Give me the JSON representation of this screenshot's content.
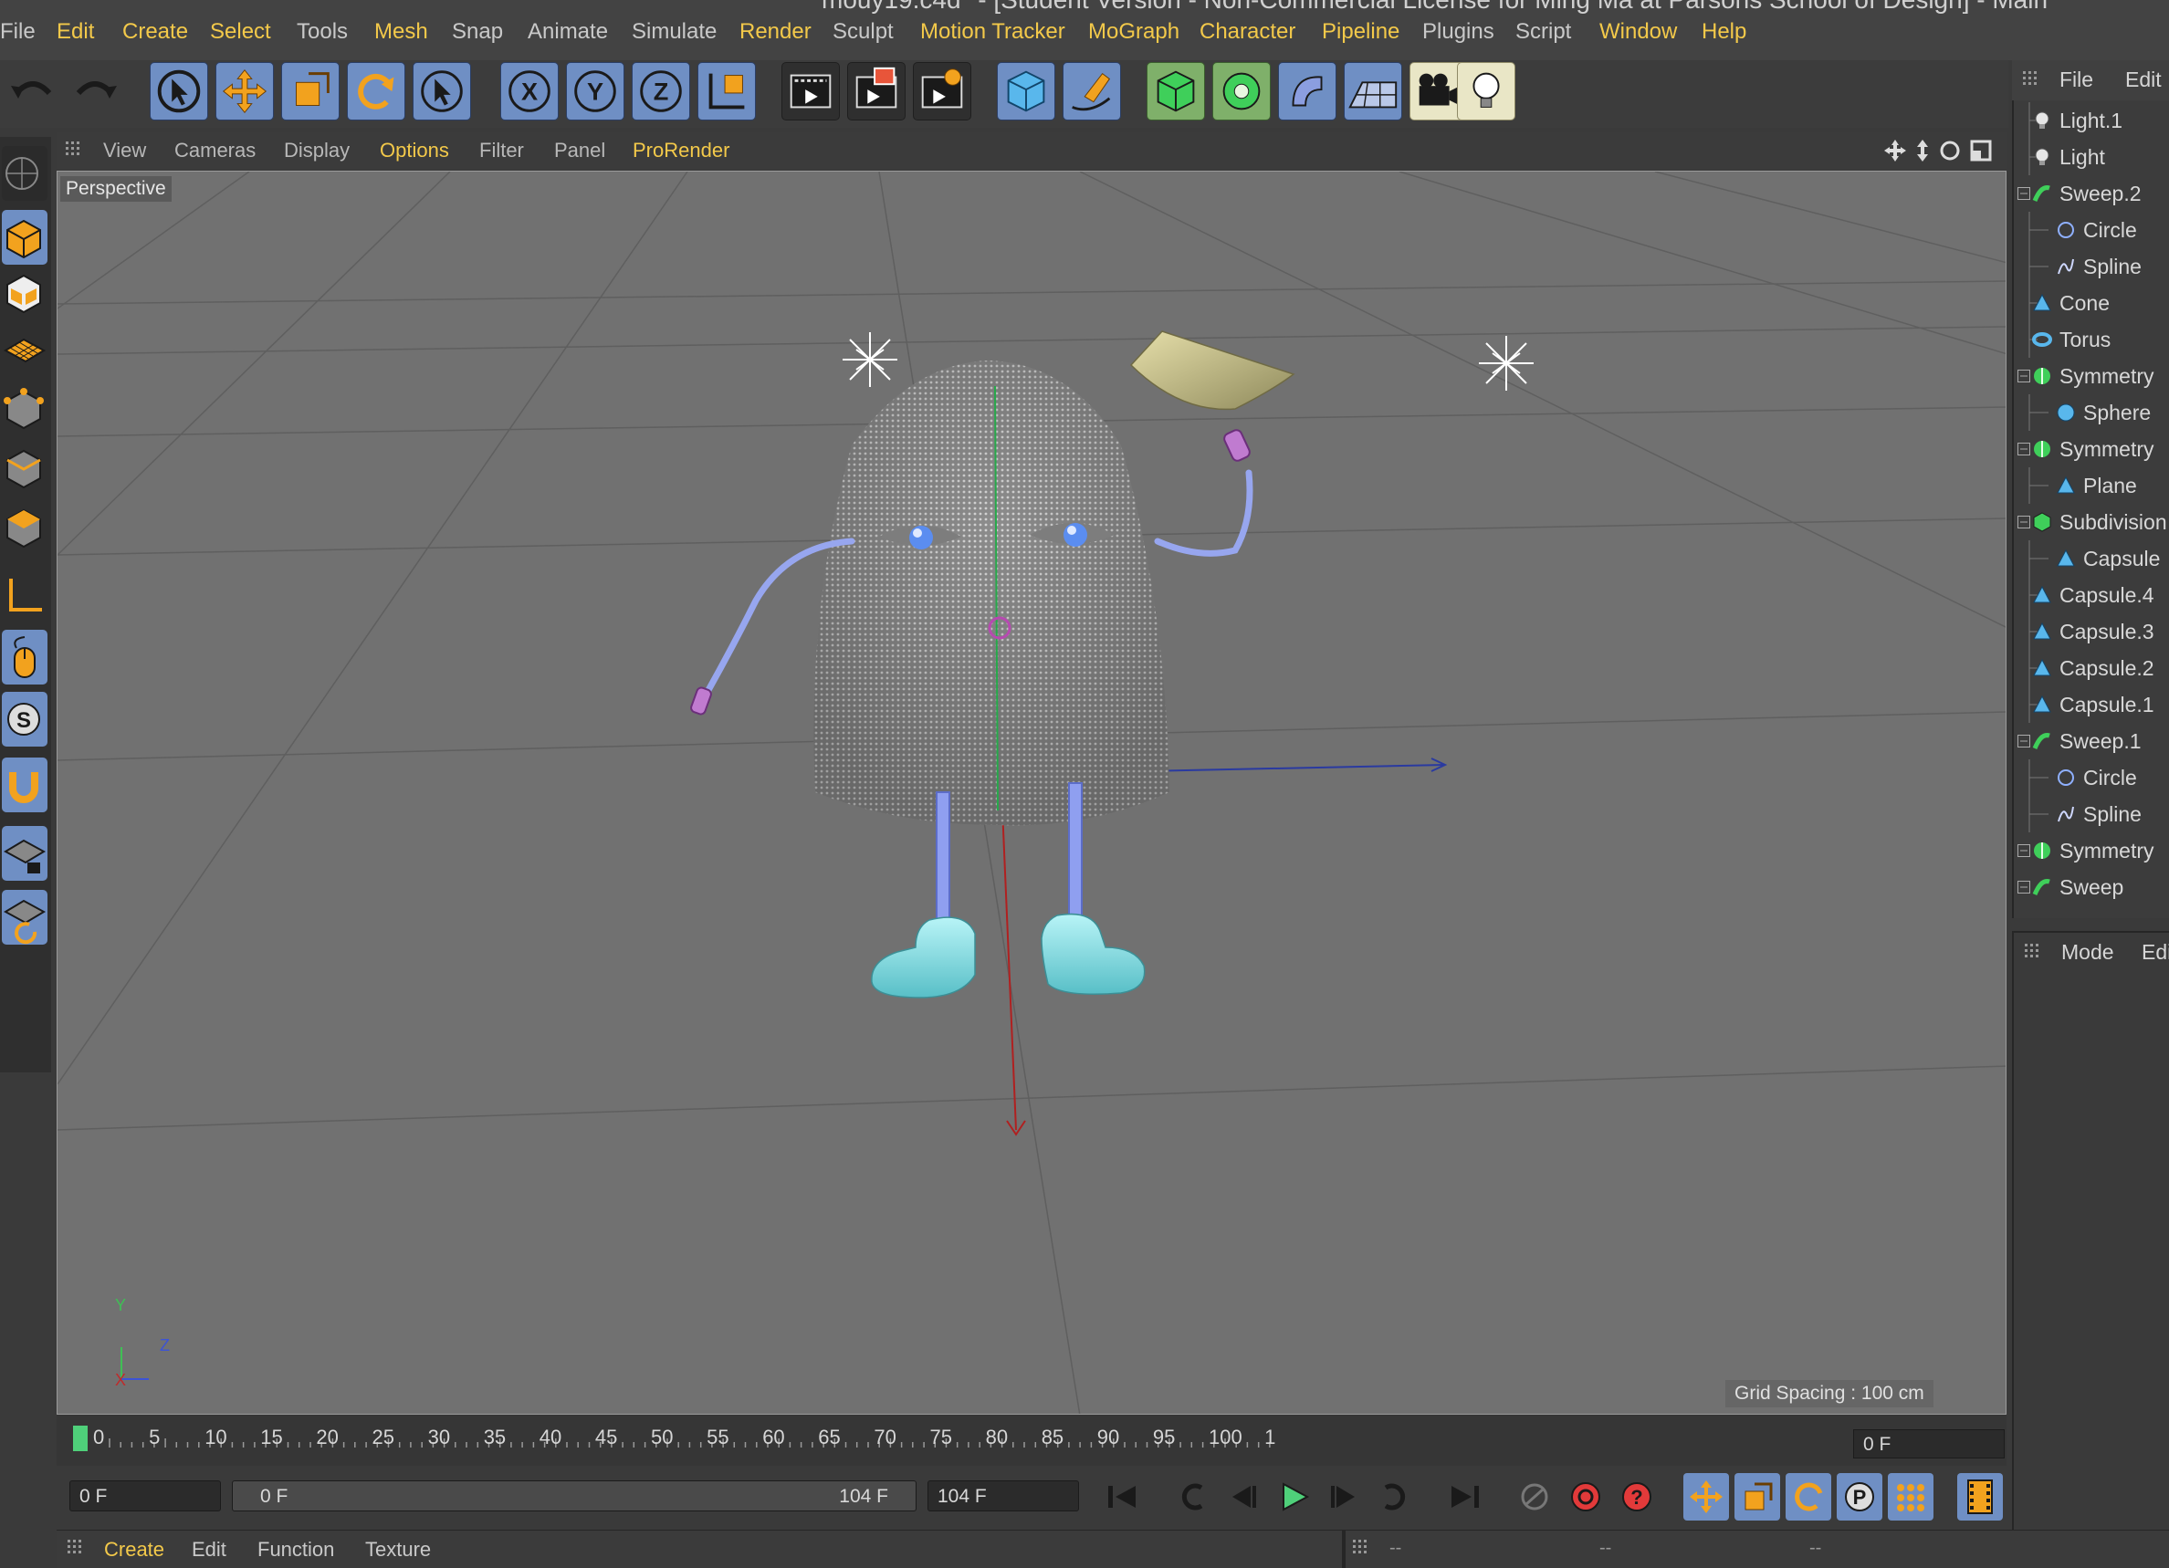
{
  "window": {
    "title": "mouy19.c4d* - [Student Version - Non-Commercial License for Ming Ma at Parsons School of Design] - Main"
  },
  "menubar": {
    "items": [
      {
        "label": "File",
        "style": "g"
      },
      {
        "label": "Edit",
        "style": "y"
      },
      {
        "label": "Create",
        "style": "y"
      },
      {
        "label": "Select",
        "style": "y"
      },
      {
        "label": "Tools",
        "style": "g"
      },
      {
        "label": "Mesh",
        "style": "y"
      },
      {
        "label": "Snap",
        "style": "g"
      },
      {
        "label": "Animate",
        "style": "g"
      },
      {
        "label": "Simulate",
        "style": "g"
      },
      {
        "label": "Render",
        "style": "y"
      },
      {
        "label": "Sculpt",
        "style": "g"
      },
      {
        "label": "Motion Tracker",
        "style": "y"
      },
      {
        "label": "MoGraph",
        "style": "y"
      },
      {
        "label": "Character",
        "style": "y"
      },
      {
        "label": "Pipeline",
        "style": "y"
      },
      {
        "label": "Plugins",
        "style": "g"
      },
      {
        "label": "Script",
        "style": "g"
      },
      {
        "label": "Window",
        "style": "y"
      },
      {
        "label": "Help",
        "style": "y"
      }
    ]
  },
  "toolbar": {
    "icons": [
      "undo-icon",
      "redo-icon",
      "live-selection-icon",
      "move-icon",
      "scale-icon",
      "rotate-icon",
      "recent-tool-icon",
      "x-axis-lock-icon",
      "y-axis-lock-icon",
      "z-axis-lock-icon",
      "world-coordinate-icon",
      "render-view-icon",
      "render-picture-viewer-icon",
      "render-settings-icon",
      "cube-primitive-icon",
      "pen-spline-icon",
      "subdivision-surface-icon",
      "cloner-icon",
      "deformer-icon",
      "floor-environment-icon",
      "camera-icon",
      "light-icon"
    ],
    "axis_labels": [
      "X",
      "Y",
      "Z"
    ]
  },
  "viewport": {
    "menu": [
      {
        "label": "View",
        "style": "g"
      },
      {
        "label": "Cameras",
        "style": "g"
      },
      {
        "label": "Display",
        "style": "g"
      },
      {
        "label": "Options",
        "style": "y"
      },
      {
        "label": "Filter",
        "style": "g"
      },
      {
        "label": "Panel",
        "style": "g"
      },
      {
        "label": "ProRender",
        "style": "y"
      }
    ],
    "camera_label": "Perspective",
    "grid_spacing": "Grid Spacing : 100 cm",
    "axis_gizmo": {
      "y": "Y",
      "z": "Z",
      "x": "X"
    }
  },
  "object_manager": {
    "menu": [
      "File",
      "Edit"
    ],
    "objects": [
      {
        "name": "Light.1",
        "icon": "light-bulb-icon",
        "indent": 0,
        "expand": false
      },
      {
        "name": "Light",
        "icon": "light-bulb-icon",
        "indent": 0,
        "expand": false
      },
      {
        "name": "Sweep.2",
        "icon": "sweep-icon",
        "indent": 0,
        "expand": true
      },
      {
        "name": "Circle",
        "icon": "circle-spline-icon",
        "indent": 1,
        "expand": false
      },
      {
        "name": "Spline",
        "icon": "spline-icon",
        "indent": 1,
        "expand": false
      },
      {
        "name": "Cone",
        "icon": "polygon-object-icon",
        "indent": 0,
        "expand": false
      },
      {
        "name": "Torus",
        "icon": "torus-icon",
        "indent": 0,
        "expand": false
      },
      {
        "name": "Symmetry",
        "icon": "symmetry-icon",
        "indent": 0,
        "expand": true
      },
      {
        "name": "Sphere",
        "icon": "sphere-icon",
        "indent": 1,
        "expand": false
      },
      {
        "name": "Symmetry",
        "icon": "symmetry-icon",
        "indent": 0,
        "expand": true
      },
      {
        "name": "Plane",
        "icon": "polygon-object-icon",
        "indent": 1,
        "expand": false
      },
      {
        "name": "Subdivision Surface",
        "icon": "subdivision-icon",
        "indent": 0,
        "expand": true
      },
      {
        "name": "Capsule",
        "icon": "polygon-object-icon",
        "indent": 1,
        "expand": false
      },
      {
        "name": "Capsule.4",
        "icon": "polygon-object-icon",
        "indent": 0,
        "expand": false
      },
      {
        "name": "Capsule.3",
        "icon": "polygon-object-icon",
        "indent": 0,
        "expand": false
      },
      {
        "name": "Capsule.2",
        "icon": "polygon-object-icon",
        "indent": 0,
        "expand": false
      },
      {
        "name": "Capsule.1",
        "icon": "polygon-object-icon",
        "indent": 0,
        "expand": false
      },
      {
        "name": "Sweep.1",
        "icon": "sweep-icon",
        "indent": 0,
        "expand": true
      },
      {
        "name": "Circle",
        "icon": "circle-spline-icon",
        "indent": 1,
        "expand": false
      },
      {
        "name": "Spline",
        "icon": "spline-icon",
        "indent": 1,
        "expand": false
      },
      {
        "name": "Symmetry",
        "icon": "symmetry-icon",
        "indent": 0,
        "expand": true
      },
      {
        "name": "Sweep",
        "icon": "sweep-icon",
        "indent": 0,
        "expand": true
      }
    ]
  },
  "attribute_manager": {
    "menu": [
      "Mode",
      "Edit"
    ]
  },
  "timeline": {
    "ticks": [
      "0",
      "5",
      "10",
      "15",
      "20",
      "25",
      "30",
      "35",
      "40",
      "45",
      "50",
      "55",
      "60",
      "65",
      "70",
      "75",
      "80",
      "85",
      "90",
      "95",
      "100",
      "1"
    ],
    "current_frame": "0 F"
  },
  "transport": {
    "start_field": "0 F",
    "range_start": "0 F",
    "range_end": "104 F",
    "end_field": "104 F"
  },
  "bottom": {
    "menu": [
      {
        "label": "Create",
        "style": "y"
      },
      {
        "label": "Edit",
        "style": "g"
      },
      {
        "label": "Function",
        "style": "g"
      },
      {
        "label": "Texture",
        "style": "g"
      }
    ],
    "coord_placeholders": [
      "--",
      "--",
      "--"
    ]
  },
  "colors": {
    "accent_yellow": "#f3c94a",
    "toolbar_blue": "#6f8fc4",
    "viewport_bg": "#717171",
    "playhead_green": "#4fd07a"
  }
}
